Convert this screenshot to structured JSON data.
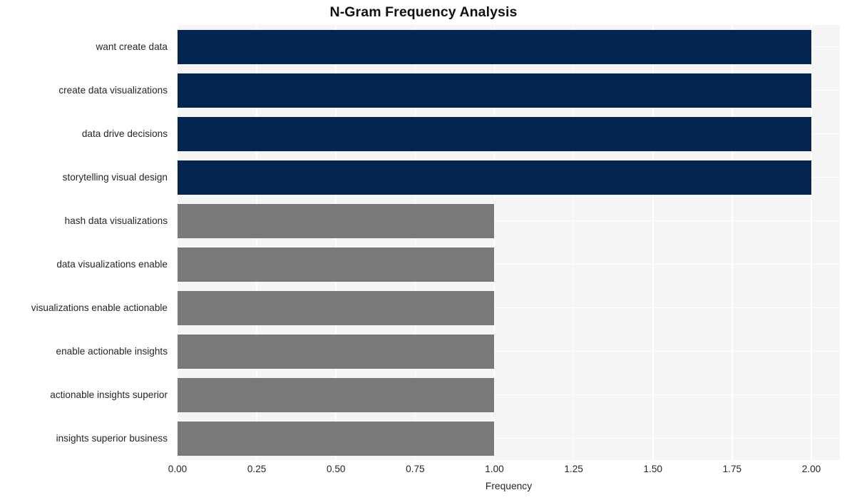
{
  "chart_data": {
    "type": "bar",
    "orientation": "horizontal",
    "title": "N-Gram Frequency Analysis",
    "xlabel": "Frequency",
    "ylabel": "",
    "categories": [
      "want create data",
      "create data visualizations",
      "data drive decisions",
      "storytelling visual design",
      "hash data visualizations",
      "data visualizations enable",
      "visualizations enable actionable",
      "enable actionable insights",
      "actionable insights superior",
      "insights superior business"
    ],
    "values": [
      2,
      2,
      2,
      2,
      1,
      1,
      1,
      1,
      1,
      1
    ],
    "bar_colors": [
      "#04254f",
      "#04254f",
      "#04254f",
      "#04254f",
      "#7b7977",
      "#7b7977",
      "#7b7977",
      "#7b7977",
      "#7b7977",
      "#7b7977"
    ],
    "xlim": [
      0,
      2.09
    ],
    "xticks": [
      0,
      0.25,
      0.5,
      0.75,
      1,
      1.25,
      1.5,
      1.75,
      2
    ],
    "xtick_labels": [
      "0.00",
      "0.25",
      "0.50",
      "0.75",
      "1.00",
      "1.25",
      "1.50",
      "1.75",
      "2.00"
    ],
    "grid": true,
    "grid_color": "#ffffff",
    "plot_background": "#f5f5f6",
    "figure_background": "#ffffff",
    "legend": null,
    "style": "seaborn-whitegrid"
  }
}
